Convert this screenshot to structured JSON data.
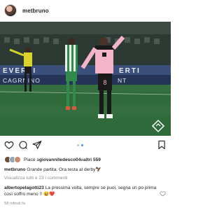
{
  "post": {
    "username": "metbruno",
    "image_alt": "football match celebration photo",
    "likes": {
      "prefix": "Piace a ",
      "user": "giovannitedesco04",
      "conj": " e ",
      "others": "altri 559"
    },
    "caption": {
      "username": "metbruno",
      "text": " Grande partita. Ora testa al derby🦅"
    },
    "view_comments": "Visualizza tutti e 23 i commenti",
    "comment": {
      "username": "albertopelagotti23",
      "text": " La prossima volta, sempre se puoi, segna un po prima così soffro meno !! 😆❤️"
    },
    "timestamp": "58 minuti fa",
    "carousel": {
      "count": 2,
      "active_index": 1
    }
  },
  "icons": {
    "more": "more-icon",
    "like": "heart-icon",
    "comment": "comment-icon",
    "share": "paper-plane-icon",
    "save": "bookmark-icon"
  },
  "colors": {
    "accent_blue": "#3897f0",
    "text_primary": "#262626",
    "text_secondary": "#8e8e8e"
  }
}
